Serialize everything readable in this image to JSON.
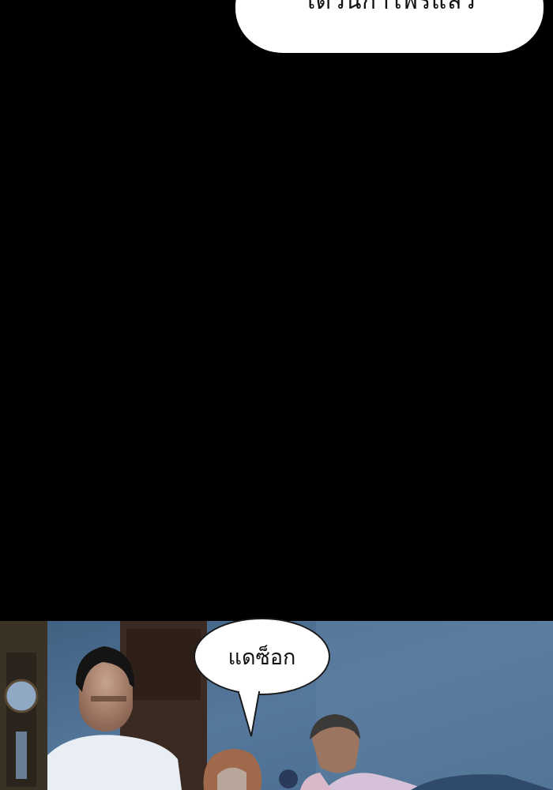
{
  "panels": {
    "top_bubble": {
      "text": "ได้วันกำไพรแล้ว"
    },
    "scene_bubble": {
      "text": "แดซ็อก"
    }
  },
  "colors": {
    "panel_background": "#000000",
    "bubble_fill": "#ffffff",
    "scene_wall": "#4a6a8a"
  }
}
